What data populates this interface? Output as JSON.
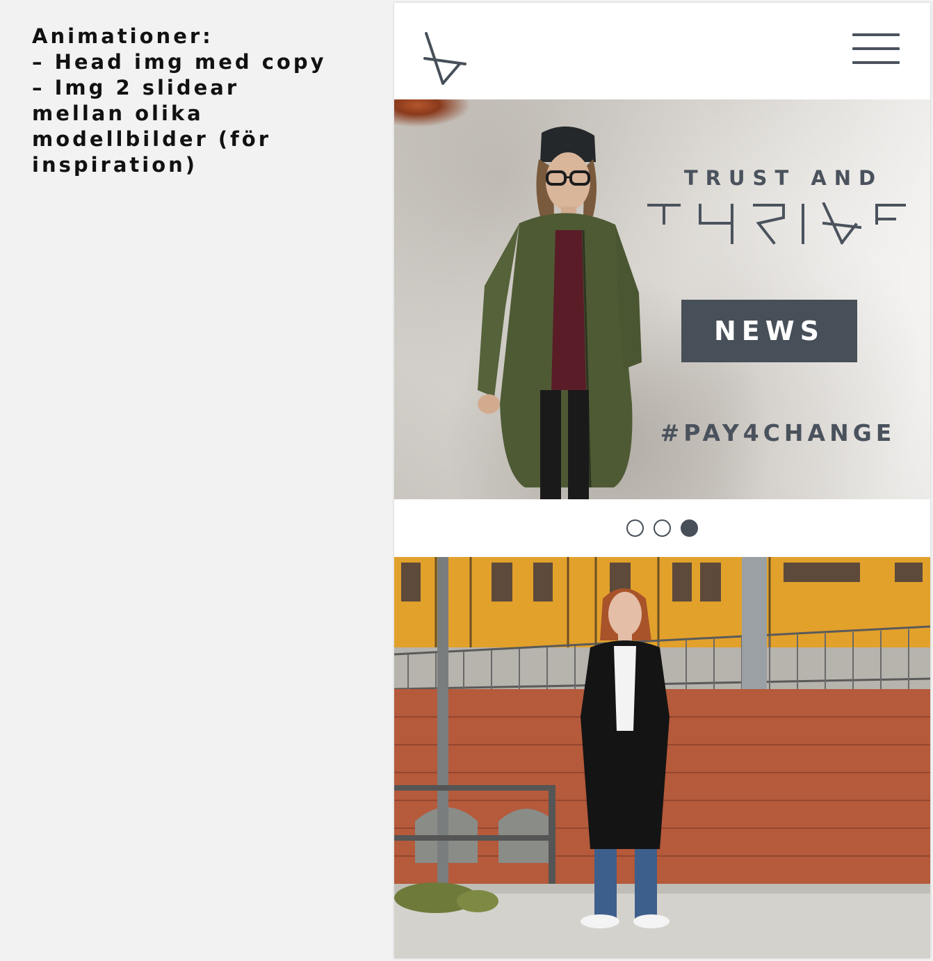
{
  "notes": {
    "lines": [
      "Animationer:",
      "– Head img med copy",
      "– Img 2 slidear",
      "mellan olika",
      "modellbilder (för",
      "inspiration)"
    ]
  },
  "header": {
    "logo_icon": "brand-logo-icon",
    "menu_icon": "hamburger-menu-icon"
  },
  "hero": {
    "eyebrow": "TRUST AND",
    "wordmark": "THRIVE",
    "cta_label": "NEWS",
    "hashtag": "#PAY4CHANGE"
  },
  "carousel": {
    "dot_count": 3,
    "active_index": 2
  },
  "colors": {
    "brand_dark": "#474f59",
    "page_bg": "#f2f2f2",
    "panel_bg": "#ffffff"
  }
}
